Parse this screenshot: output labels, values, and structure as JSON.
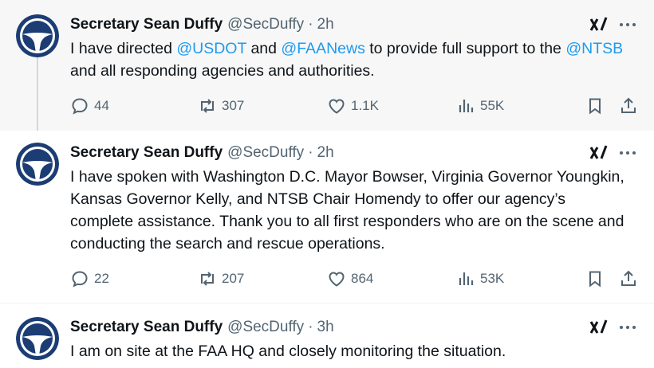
{
  "tweets": [
    {
      "author": {
        "name": "Secretary Sean Duffy",
        "handle": "@SecDuffy",
        "time": "2h"
      },
      "text": [
        {
          "t": "I have directed "
        },
        {
          "t": "@USDOT",
          "mention": true
        },
        {
          "t": " and "
        },
        {
          "t": "@FAANews",
          "mention": true
        },
        {
          "t": " to provide full support to the "
        },
        {
          "t": "@NTSB",
          "mention": true
        },
        {
          "t": " and all responding agencies and authorities."
        }
      ],
      "stats": {
        "replies": "44",
        "reposts": "307",
        "likes": "1.1K",
        "views": "55K"
      }
    },
    {
      "author": {
        "name": "Secretary Sean Duffy",
        "handle": "@SecDuffy",
        "time": "2h"
      },
      "text": [
        {
          "t": "I have spoken with Washington D.C. Mayor Bowser, Virginia Governor Youngkin, Kansas Governor Kelly, and NTSB Chair Homendy to offer our agency’s complete assistance. Thank you to all first responders who are on the scene and conducting the search and rescue operations."
        }
      ],
      "stats": {
        "replies": "22",
        "reposts": "207",
        "likes": "864",
        "views": "53K"
      }
    },
    {
      "author": {
        "name": "Secretary Sean Duffy",
        "handle": "@SecDuffy",
        "time": "3h"
      },
      "text": [
        {
          "t": "I am on site at the FAA HQ and closely monitoring the situation."
        }
      ]
    }
  ],
  "sep": "·",
  "colors": {
    "mention": "#1d9bf0",
    "muted": "#536471",
    "avatar": "#1c3d74",
    "highlight_bg": "#f7f7f7"
  },
  "icons": [
    "dot-logo-icon",
    "grok-icon",
    "more-icon",
    "reply-icon",
    "repost-icon",
    "like-icon",
    "views-icon",
    "bookmark-icon",
    "share-icon"
  ]
}
